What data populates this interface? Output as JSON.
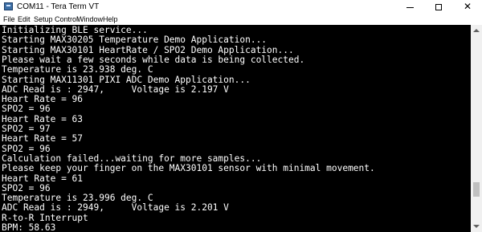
{
  "window": {
    "title": "COM11 - Tera Term VT"
  },
  "menu": {
    "items": [
      "File",
      "Edit",
      "Setup",
      "Control",
      "Window",
      "Help"
    ]
  },
  "terminal": {
    "lines": [
      "Initializing BLE service...",
      "Starting MAX30205 Temperature Demo Application...",
      "Starting MAX30101 HeartRate / SPO2 Demo Application...",
      "Please wait a few seconds while data is being collected.",
      "Temperature is 23.938 deg. C",
      "Starting MAX11301 PIXI ADC Demo Application...",
      "ADC Read is : 2947,     Voltage is 2.197 V",
      "Heart Rate = 96",
      "SPO2 = 96",
      "Heart Rate = 63",
      "SPO2 = 97",
      "Heart Rate = 57",
      "SPO2 = 96",
      "Calculation failed...waiting for more samples...",
      "Please keep your finger on the MAX30101 sensor with minimal movement.",
      "Heart Rate = 61",
      "SPO2 = 96",
      "Temperature is 23.996 deg. C",
      "ADC Read is : 2949,     Voltage is 2.201 V",
      "R-to-R Interrupt",
      "BPM: 58.63"
    ]
  },
  "scrollbar": {
    "position_fraction": 0.86,
    "visible_fraction": 0.08
  },
  "colors": {
    "background": "#000000",
    "text": "#ffffff"
  }
}
